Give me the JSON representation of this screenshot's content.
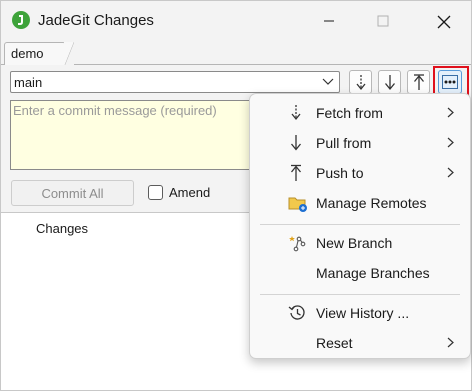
{
  "window": {
    "title": "JadeGit Changes"
  },
  "tabs": [
    {
      "label": "demo"
    }
  ],
  "branch": {
    "selected": "main"
  },
  "commit": {
    "placeholder": "Enter a commit message (required)",
    "commit_all_label": "Commit All",
    "amend_label": "Amend",
    "amend_checked": false
  },
  "changes": {
    "heading": "Changes"
  },
  "toolbar": {
    "fetch_icon": "fetch-arrow-icon",
    "pull_icon": "pull-arrow-icon",
    "push_icon": "push-arrow-icon",
    "more_icon": "more-ellipsis-icon"
  },
  "menu": {
    "items": [
      {
        "label": "Fetch from",
        "icon": "fetch-icon",
        "submenu": true
      },
      {
        "label": "Pull from",
        "icon": "pull-icon",
        "submenu": true
      },
      {
        "label": "Push to",
        "icon": "push-icon",
        "submenu": true
      },
      {
        "label": "Manage Remotes",
        "icon": "remotes-folder-icon",
        "submenu": false
      },
      {
        "label": "New Branch",
        "icon": "new-branch-icon",
        "submenu": false
      },
      {
        "label": "Manage Branches",
        "icon": "",
        "submenu": false
      },
      {
        "label": "View History ...",
        "icon": "history-icon",
        "submenu": false
      },
      {
        "label": "Reset",
        "icon": "",
        "submenu": true
      }
    ]
  },
  "colors": {
    "accent_highlight": "#e0101c",
    "commit_box_bg": "#ffffe1",
    "logo_green": "#3ea33a"
  }
}
